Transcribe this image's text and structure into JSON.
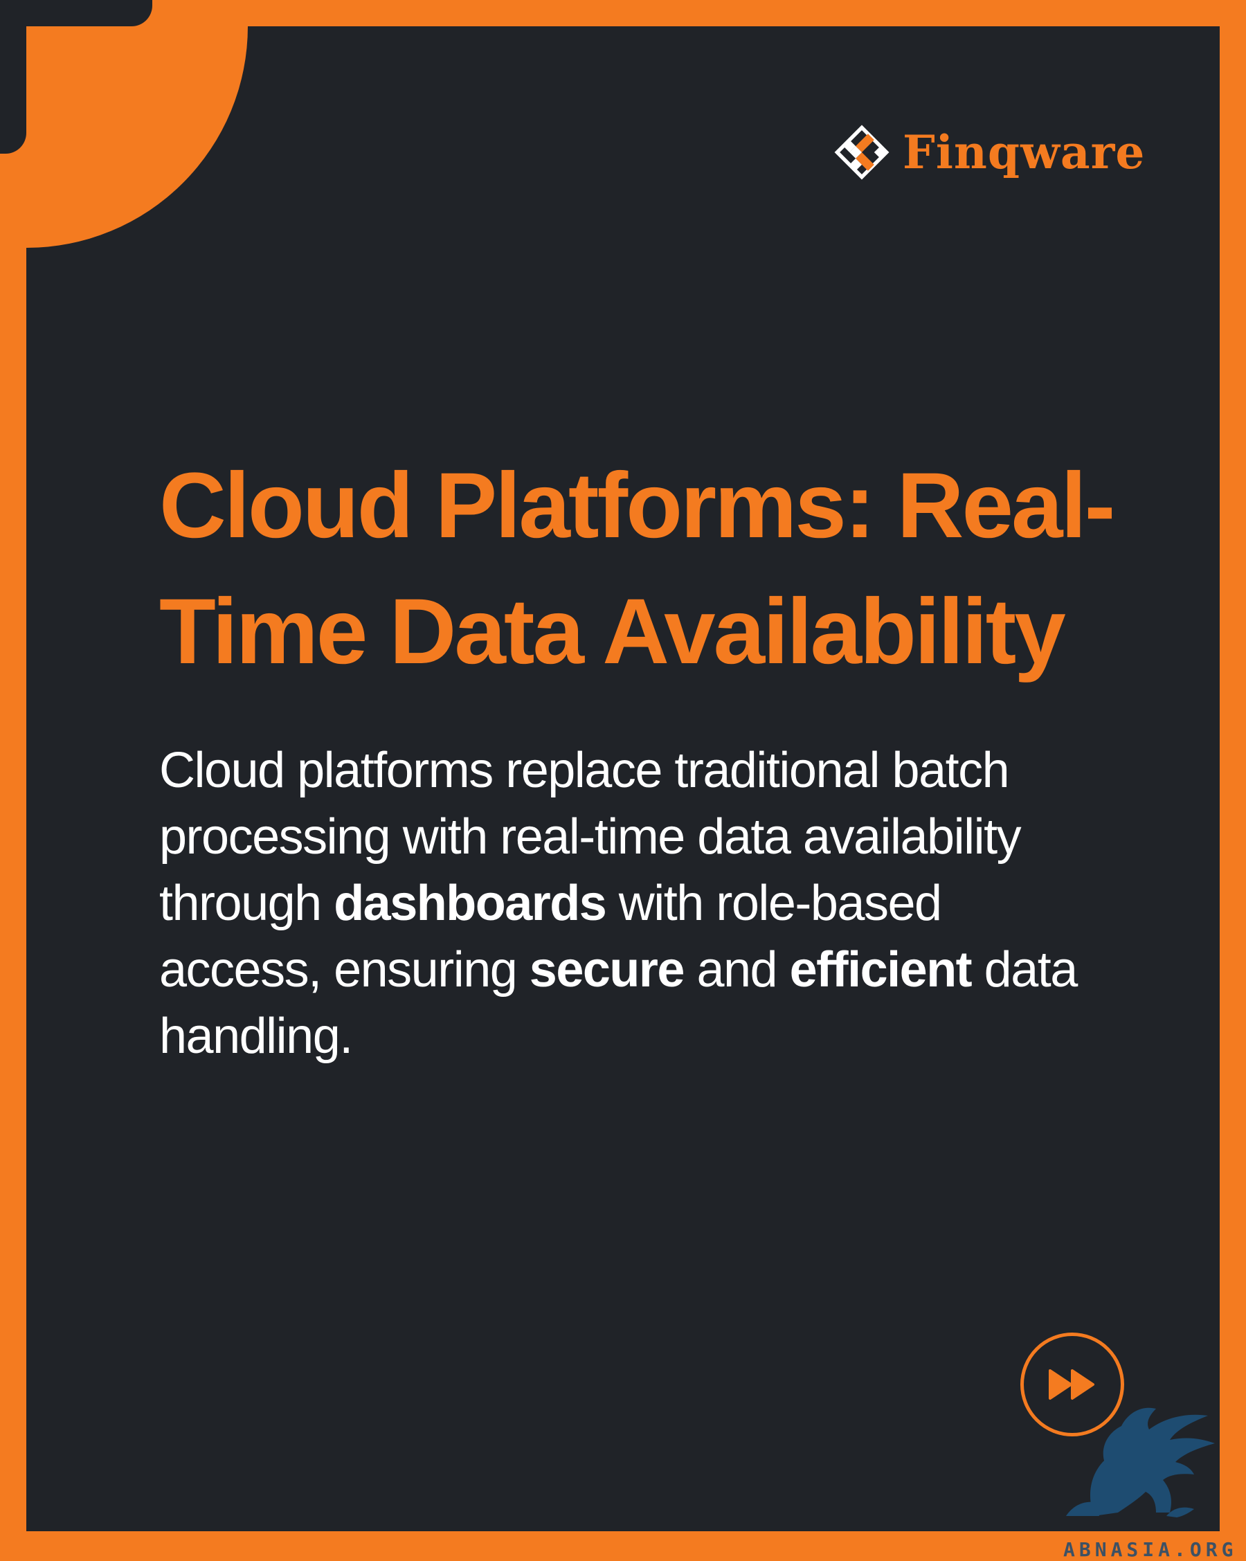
{
  "brand": {
    "name": "Finqware",
    "logo_icon": "diamond-grid-logo-icon"
  },
  "slide": {
    "title": "Cloud Platforms: Real-Time Data Availability",
    "body": {
      "part1": "Cloud platforms replace traditional batch processing with real-time data availability through ",
      "bold1": "dashboards",
      "part2": " with role-based access, ensuring ",
      "bold2": "secure",
      "part3": " and ",
      "bold3": "efficient",
      "part4": " data handling."
    }
  },
  "navigation": {
    "next_icon": "fast-forward-icon"
  },
  "watermark": {
    "text": "ABNASIA.ORG",
    "icon": "griffin-icon"
  },
  "colors": {
    "accent": "#f47b20",
    "background": "#202328",
    "text": "#ffffff",
    "watermark": "#1e4a70"
  }
}
